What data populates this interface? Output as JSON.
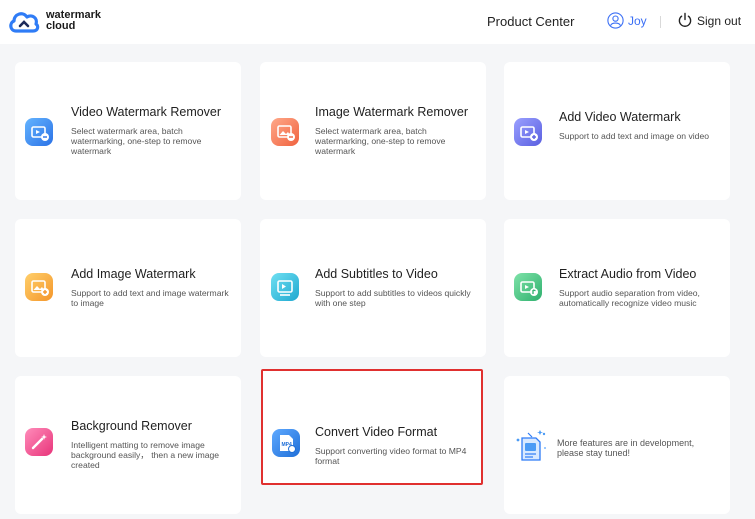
{
  "header": {
    "logo_line1": "watermark",
    "logo_line2": "cloud",
    "product_center": "Product Center",
    "user_name": "Joy",
    "sign_out": "Sign out"
  },
  "cards": [
    {
      "title": "Video Watermark Remover",
      "desc": "Select watermark area, batch watermarking, one-step to remove watermark",
      "icon": "video-remove-icon",
      "color": "#3c8ef0"
    },
    {
      "title": "Image Watermark Remover",
      "desc": "Select watermark area, batch watermarking, one-step to remove watermark",
      "icon": "image-remove-icon",
      "color": "#f57a5b"
    },
    {
      "title": "Add Video Watermark",
      "desc": "Support to add text and image on video",
      "icon": "video-add-icon",
      "color": "#6f75ee"
    },
    {
      "title": "Add Image Watermark",
      "desc": "Support to add text and image watermark to image",
      "icon": "image-add-icon",
      "color": "#f7a93c"
    },
    {
      "title": "Add Subtitles to Video",
      "desc": "Support to add subtitles to videos quickly with one step",
      "icon": "subtitle-icon",
      "color": "#2ebfdc"
    },
    {
      "title": "Extract Audio from Video",
      "desc": "Support audio separation from video, automatically recognize video music",
      "icon": "audio-extract-icon",
      "color": "#43c488"
    },
    {
      "title": "Background Remover",
      "desc": "Intelligent matting to remove image background easily， then a new image created",
      "icon": "magic-wand-icon",
      "color": "#f04e8c"
    },
    {
      "title": "Convert Video Format",
      "desc": "Support converting video format to MP4 format",
      "icon": "mp4-file-icon",
      "color": "#2e84e8"
    },
    {
      "title": "",
      "desc": "More features are in development, please stay tuned!",
      "icon": "more-features-icon",
      "color": "#3c8ef0"
    }
  ],
  "icon_labels": {
    "mp4": "MP4"
  }
}
